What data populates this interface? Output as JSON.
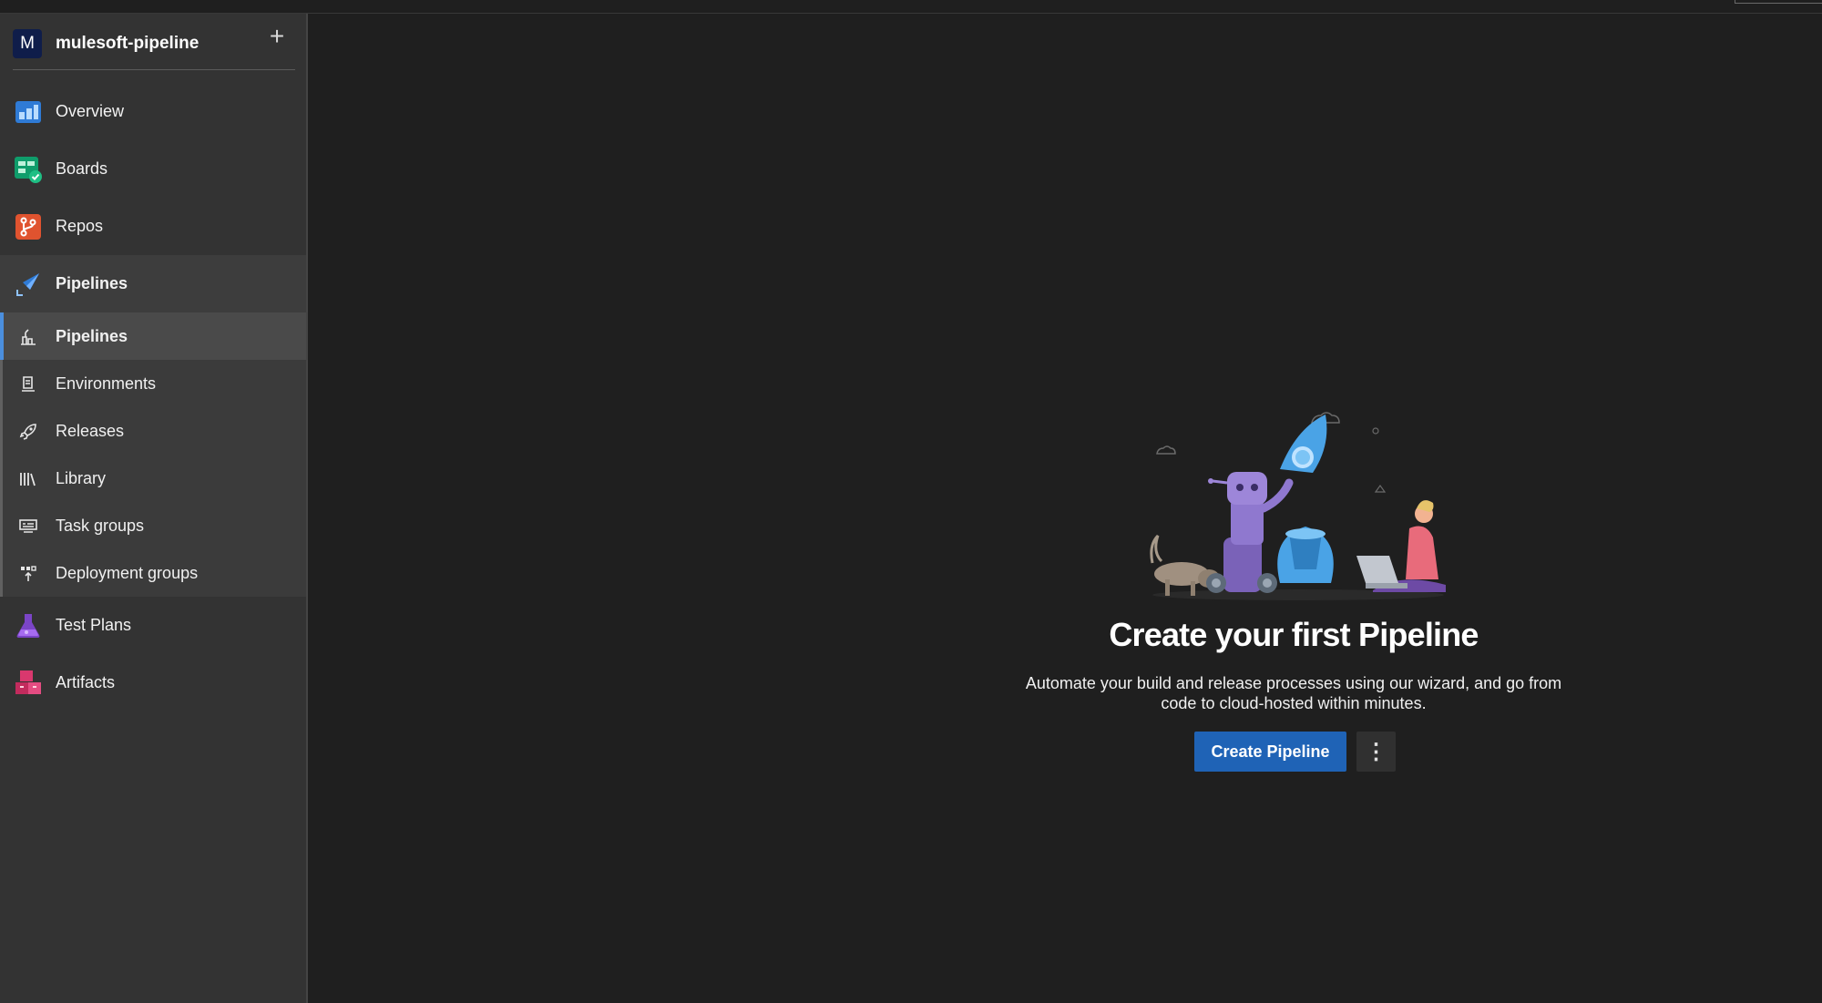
{
  "project": {
    "initial": "M",
    "name": "mulesoft-pipeline",
    "add_icon": "plus-icon"
  },
  "nav": {
    "overview": {
      "label": "Overview",
      "icon": "overview-icon"
    },
    "boards": {
      "label": "Boards",
      "icon": "boards-icon"
    },
    "repos": {
      "label": "Repos",
      "icon": "repos-icon"
    },
    "pipelines": {
      "label": "Pipelines",
      "icon": "pipelines-icon"
    },
    "test_plans": {
      "label": "Test Plans",
      "icon": "test-plans-icon"
    },
    "artifacts": {
      "label": "Artifacts",
      "icon": "artifacts-icon"
    }
  },
  "subnav": {
    "pipelines": {
      "label": "Pipelines",
      "icon": "pipelines-list-icon"
    },
    "environments": {
      "label": "Environments",
      "icon": "environments-icon"
    },
    "releases": {
      "label": "Releases",
      "icon": "releases-icon"
    },
    "library": {
      "label": "Library",
      "icon": "library-icon"
    },
    "task_groups": {
      "label": "Task groups",
      "icon": "task-groups-icon"
    },
    "deployment_groups": {
      "label": "Deployment groups",
      "icon": "deployment-groups-icon"
    }
  },
  "empty_state": {
    "title": "Create your first Pipeline",
    "description_line1": "Automate your build and release processes using our wizard, and go from",
    "description_line2": "code to cloud-hosted within minutes.",
    "primary_button": "Create Pipeline",
    "more_button": "⋮"
  },
  "colors": {
    "background": "#1f1f1f",
    "sidebar": "#333333",
    "accent": "#1f63b6",
    "selection_bar": "#4b8fde"
  }
}
